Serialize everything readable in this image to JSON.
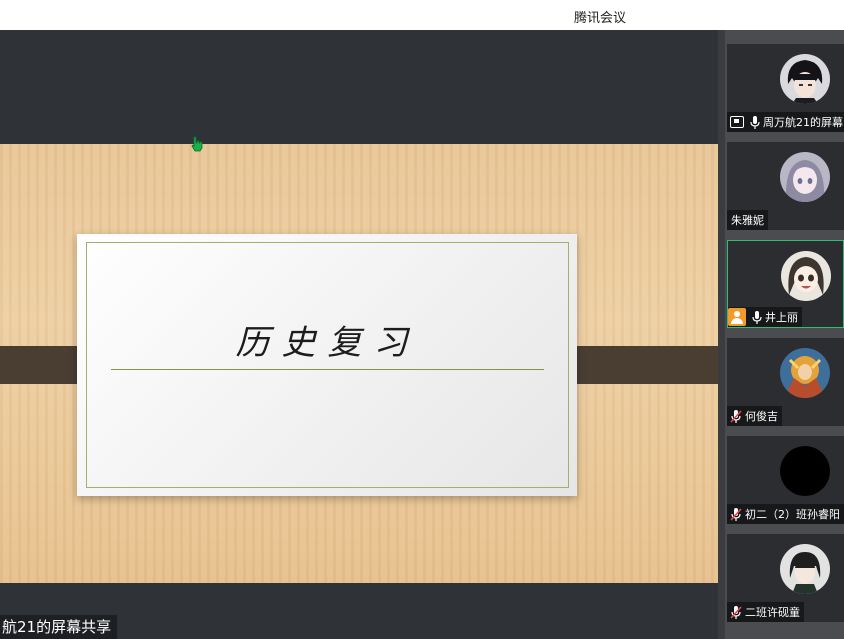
{
  "window": {
    "app_title": "腾讯会议"
  },
  "slide": {
    "title": "历史复习"
  },
  "share_label": "航21的屏幕共享",
  "participants": [
    {
      "name": "周万航21的屏幕",
      "mic": "on",
      "sharing": true,
      "avatar": "anime-boy-avatar"
    },
    {
      "name": "朱雅妮",
      "mic": "none",
      "avatar": "anime-girl-avatar"
    },
    {
      "name": "井上丽",
      "mic": "on",
      "active": true,
      "user_badge": true,
      "avatar": "anime-girl-avatar"
    },
    {
      "name": "何俊吉",
      "mic": "muted",
      "avatar": "game-character-avatar"
    },
    {
      "name": "初二（2）班孙睿阳",
      "mic": "muted",
      "avatar": "black-circle-avatar"
    },
    {
      "name": "二班许砚童",
      "mic": "muted",
      "avatar": "anime-boy-avatar"
    }
  ],
  "colors": {
    "accent_active_border": "#2fbf71",
    "user_badge": "#f39a2b",
    "muted_mic": "#e5484d"
  }
}
